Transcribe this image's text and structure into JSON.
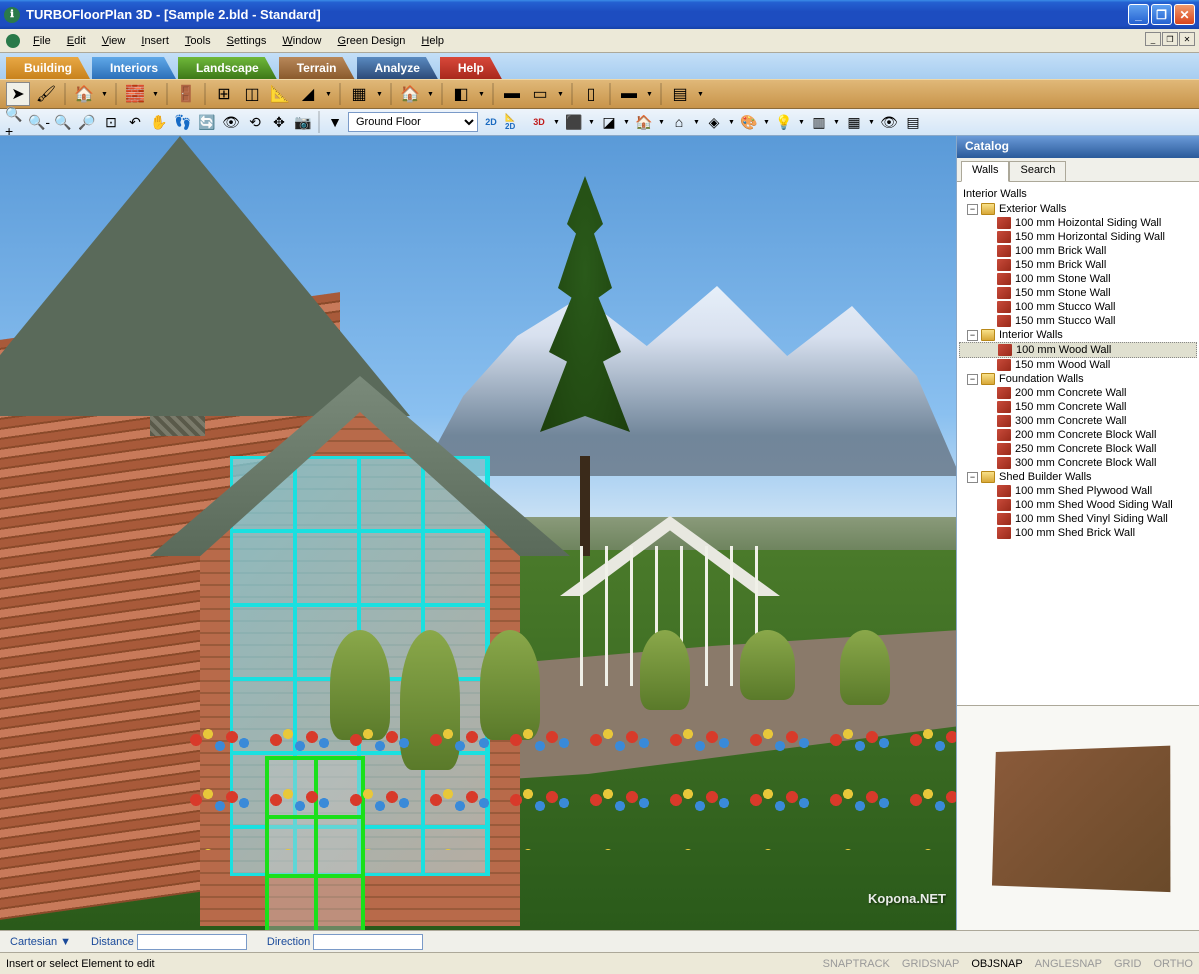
{
  "window": {
    "title": "TURBOFloorPlan 3D - [Sample 2.bld - Standard]"
  },
  "menu": {
    "items": [
      "File",
      "Edit",
      "View",
      "Insert",
      "Tools",
      "Settings",
      "Window",
      "Green Design",
      "Help"
    ]
  },
  "tabs": {
    "building": "Building",
    "interiors": "Interiors",
    "landscape": "Landscape",
    "terrain": "Terrain",
    "analyze": "Analyze",
    "help": "Help"
  },
  "floor_selector": {
    "value": "Ground Floor"
  },
  "catalog": {
    "title": "Catalog",
    "tabs": {
      "walls": "Walls",
      "search": "Search"
    },
    "root": "Interior Walls",
    "groups": [
      {
        "name": "Exterior Walls",
        "items": [
          "100 mm Hoizontal Siding Wall",
          "150 mm Horizontal Siding Wall",
          "100 mm Brick Wall",
          "150 mm Brick Wall",
          "100 mm Stone Wall",
          "150 mm Stone Wall",
          "100 mm Stucco Wall",
          "150 mm Stucco Wall"
        ]
      },
      {
        "name": "Interior Walls",
        "items": [
          "100 mm Wood Wall",
          "150 mm Wood Wall"
        ],
        "selected": 0
      },
      {
        "name": "Foundation Walls",
        "items": [
          "200 mm Concrete Wall",
          "150 mm Concrete Wall",
          "300 mm Concrete Wall",
          "200 mm Concrete Block Wall",
          "250 mm Concrete Block Wall",
          "300 mm Concrete Block Wall"
        ]
      },
      {
        "name": "Shed Builder Walls",
        "items": [
          "100 mm Shed Plywood Wall",
          "100 mm Shed Wood Siding Wall",
          "100 mm Shed Vinyl Siding Wall",
          "100 mm Shed Brick Wall"
        ]
      }
    ]
  },
  "coordbar": {
    "mode": "Cartesian ▼",
    "distance_label": "Distance",
    "distance_value": "",
    "direction_label": "Direction",
    "direction_value": ""
  },
  "status": {
    "message": "Insert or select Element to edit",
    "modes": [
      "SNAPTRACK",
      "GRIDSNAP",
      "OBJSNAP",
      "ANGLESNAP",
      "GRID",
      "ORTHO"
    ],
    "active_mode": "OBJSNAP"
  },
  "watermark": "Kopona.NET"
}
